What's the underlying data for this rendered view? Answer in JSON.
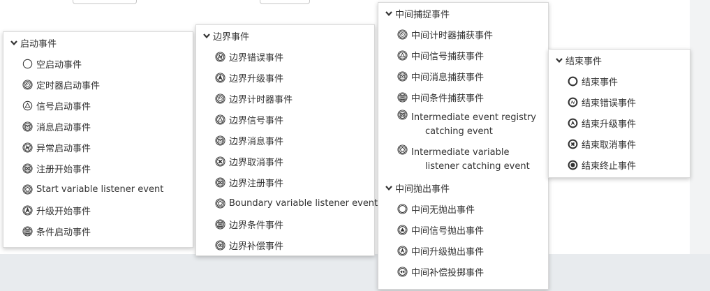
{
  "panels": [
    {
      "groups": [
        {
          "title": "启动事件",
          "items": [
            {
              "label": "空启动事件",
              "icon": "start-none-icon"
            },
            {
              "label": "定时器启动事件",
              "icon": "timer-icon"
            },
            {
              "label": "信号启动事件",
              "icon": "signal-icon"
            },
            {
              "label": "消息启动事件",
              "icon": "message-icon"
            },
            {
              "label": "异常启动事件",
              "icon": "error-icon"
            },
            {
              "label": "注册开始事件",
              "icon": "registry-icon"
            },
            {
              "label": "Start variable listener event",
              "icon": "variable-listener-icon"
            },
            {
              "label": "升级开始事件",
              "icon": "escalation-icon"
            },
            {
              "label": "条件启动事件",
              "icon": "conditional-icon"
            }
          ]
        }
      ]
    },
    {
      "groups": [
        {
          "title": "边界事件",
          "items": [
            {
              "label": "边界错误事件",
              "icon": "error-icon"
            },
            {
              "label": "边界升级事件",
              "icon": "escalation-icon"
            },
            {
              "label": "边界计时器事件",
              "icon": "timer-icon"
            },
            {
              "label": "边界信号事件",
              "icon": "signal-outline-icon"
            },
            {
              "label": "边界消息事件",
              "icon": "message-icon"
            },
            {
              "label": "边界取消事件",
              "icon": "cancel-icon"
            },
            {
              "label": "边界注册事件",
              "icon": "registry-icon"
            },
            {
              "label": "Boundary variable listener event",
              "icon": "variable-listener-icon"
            },
            {
              "label": "边界条件事件",
              "icon": "conditional-icon"
            },
            {
              "label": "边界补偿事件",
              "icon": "compensation-icon"
            }
          ]
        }
      ]
    },
    {
      "groups": [
        {
          "title": "中间捕捉事件",
          "items": [
            {
              "label": "中间计时器捕获事件",
              "icon": "timer-icon"
            },
            {
              "label": "中间信号捕获事件",
              "icon": "signal-outline-icon"
            },
            {
              "label": "中间消息捕获事件",
              "icon": "message-icon"
            },
            {
              "label": "中间条件捕获事件",
              "icon": "conditional-icon"
            },
            {
              "label": "Intermediate event registry catching event",
              "icon": "registry-icon",
              "two_line": true
            },
            {
              "label": "Intermediate variable listener catching event",
              "icon": "variable-listener-icon",
              "two_line": true
            }
          ]
        },
        {
          "title": "中间抛出事件",
          "items": [
            {
              "label": "中间无抛出事件",
              "icon": "throw-none-icon"
            },
            {
              "label": "中间信号抛出事件",
              "icon": "signal-throw-icon"
            },
            {
              "label": "中间升级抛出事件",
              "icon": "escalation-throw-icon"
            },
            {
              "label": "中间补偿投掷事件",
              "icon": "compensation-throw-icon"
            }
          ]
        }
      ]
    },
    {
      "groups": [
        {
          "title": "结束事件",
          "items": [
            {
              "label": "结束事件",
              "icon": "end-none-icon"
            },
            {
              "label": "结束错误事件",
              "icon": "end-error-icon"
            },
            {
              "label": "结束升级事件",
              "icon": "end-escalation-icon"
            },
            {
              "label": "结束取消事件",
              "icon": "end-cancel-icon"
            },
            {
              "label": "结束终止事件",
              "icon": "end-terminate-icon"
            }
          ]
        }
      ]
    }
  ]
}
